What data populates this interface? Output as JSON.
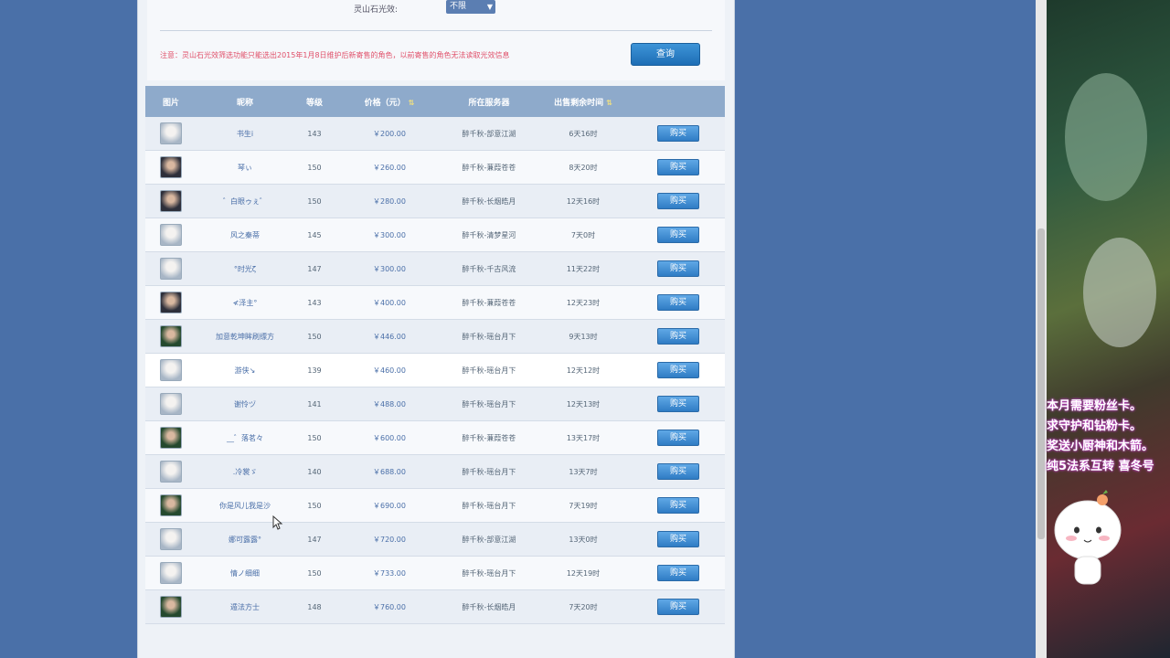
{
  "filter": {
    "label": "灵山石光效:",
    "select_value": "不限",
    "note": "注意：灵山石光效筛选功能只能选出2015年1月8日维护后新寄售的角色，以前寄售的角色无法读取光效信息",
    "query_label": "查询"
  },
  "table": {
    "headers": {
      "image": "图片",
      "name": "昵称",
      "level": "等级",
      "price": "价格（元）",
      "server": "所在服务器",
      "time_left": "出售剩余时间"
    },
    "buy_label": "购买",
    "rows": [
      {
        "avatar": "light",
        "name": "书生i",
        "level": "143",
        "price": "￥200.00",
        "server": "醉千秋-部意江湖",
        "time": "6天16时"
      },
      {
        "avatar": "dark",
        "name": "琴ぃ",
        "level": "150",
        "price": "￥260.00",
        "server": "醉千秋-蒹葭苍苍",
        "time": "8天20时"
      },
      {
        "avatar": "dark",
        "name": "゛白眼ゥぇ゛",
        "level": "150",
        "price": "￥280.00",
        "server": "醉千秋-长烟皓月",
        "time": "12天16时"
      },
      {
        "avatar": "light",
        "name": "风之秦蒂",
        "level": "145",
        "price": "￥300.00",
        "server": "醉千秋-清梦星河",
        "time": "7天0时"
      },
      {
        "avatar": "light",
        "name": "°时光ζ",
        "level": "147",
        "price": "￥300.00",
        "server": "醉千秋-千古风流",
        "time": "11天22时"
      },
      {
        "avatar": "dark",
        "name": "≮泽主°",
        "level": "143",
        "price": "￥400.00",
        "server": "醉千秋-蒹葭苍苍",
        "time": "12天23时"
      },
      {
        "avatar": "green",
        "name": "加意乾坤眸刷缥方",
        "level": "150",
        "price": "￥446.00",
        "server": "醉千秋-瑶台月下",
        "time": "9天13时"
      },
      {
        "avatar": "light",
        "name": "游侠↘",
        "level": "139",
        "price": "￥460.00",
        "server": "醉千秋-瑶台月下",
        "time": "12天12时"
      },
      {
        "avatar": "light",
        "name": "谢怜ヅ",
        "level": "141",
        "price": "￥488.00",
        "server": "醉千秋-瑶台月下",
        "time": "12天13时"
      },
      {
        "avatar": "green",
        "name": "__゛落茗々",
        "level": "150",
        "price": "￥600.00",
        "server": "醉千秋-蒹葭苍苍",
        "time": "13天17时"
      },
      {
        "avatar": "light",
        "name": ".冷裳ゞ",
        "level": "140",
        "price": "￥688.00",
        "server": "醉千秋-瑶台月下",
        "time": "13天7时"
      },
      {
        "avatar": "green",
        "name": "你是风儿我是沙",
        "level": "150",
        "price": "￥690.00",
        "server": "醉千秋-瑶台月下",
        "time": "7天19时"
      },
      {
        "avatar": "light",
        "name": "娜可露露°",
        "level": "147",
        "price": "￥720.00",
        "server": "醉千秋-部意江湖",
        "time": "13天0时"
      },
      {
        "avatar": "light",
        "name": "情ノ细细",
        "level": "150",
        "price": "￥733.00",
        "server": "醉千秋-瑶台月下",
        "time": "12天19时"
      },
      {
        "avatar": "green",
        "name": "遁法方士",
        "level": "148",
        "price": "￥760.00",
        "server": "醉千秋-长烟皓月",
        "time": "7天20时"
      }
    ]
  },
  "stream_overlay": {
    "lines": [
      "本月需要粉丝卡。",
      "求守护和钻粉卡。",
      "奖送小厨神和木箭。",
      "纯5法系互转  喜冬号"
    ]
  },
  "colors": {
    "page_bg": "#4a70a8",
    "header_bg": "#8eaacb",
    "buy_button": "#2f7cc4",
    "note_text": "#e0506a"
  }
}
